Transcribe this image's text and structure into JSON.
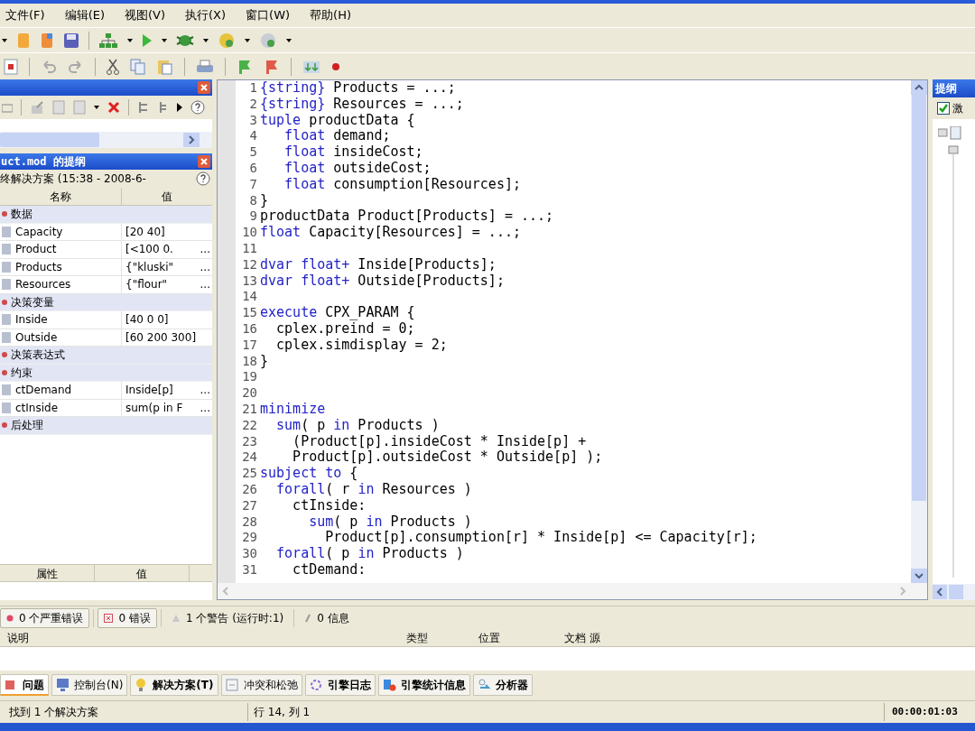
{
  "menu": [
    "文件(F)",
    "编辑(E)",
    "视图(V)",
    "执行(X)",
    "窗口(W)",
    "帮助(H)"
  ],
  "outline_panel": {
    "title": "uct.mod 的提纲",
    "solution": "终解决方案 (15:38 - 2008-6-",
    "columns": [
      "名称",
      "值"
    ],
    "groups": [
      {
        "label": "数据",
        "items": [
          {
            "name": "Capacity",
            "value": "[20 40]"
          },
          {
            "name": "Product",
            "value": "[<100 0.",
            "more": "..."
          },
          {
            "name": "Products",
            "value": "{\"kluski\"",
            "more": "..."
          },
          {
            "name": "Resources",
            "value": "{\"flour\"",
            "more": "..."
          }
        ]
      },
      {
        "label": "决策变量",
        "items": [
          {
            "name": "Inside",
            "value": "[40 0 0]"
          },
          {
            "name": "Outside",
            "value": "[60 200 300]"
          }
        ]
      },
      {
        "label": "决策表达式"
      },
      {
        "label": "约束",
        "items": [
          {
            "name": "ctDemand",
            "value": "Inside[p]",
            "more": "..."
          },
          {
            "name": "ctInside",
            "value": "sum(p in F",
            "more": "..."
          }
        ]
      },
      {
        "label": "后处理"
      }
    ],
    "property_columns": [
      "属性",
      "值"
    ]
  },
  "editor": {
    "lines": [
      {
        "n": "1",
        "tokens": [
          {
            "t": "{string}",
            "kind": "keyword"
          },
          {
            "t": " Products = ...;",
            "kind": "plain"
          }
        ]
      },
      {
        "n": "2",
        "tokens": [
          {
            "t": "{string}",
            "kind": "keyword"
          },
          {
            "t": " Resources = ...;",
            "kind": "plain"
          }
        ]
      },
      {
        "n": "3",
        "tokens": [
          {
            "t": "tuple",
            "kind": "keyword"
          },
          {
            "t": " productData {",
            "kind": "plain"
          }
        ]
      },
      {
        "n": "4",
        "tokens": [
          {
            "t": "   float",
            "kind": "keyword"
          },
          {
            "t": " demand;",
            "kind": "plain"
          }
        ]
      },
      {
        "n": "5",
        "tokens": [
          {
            "t": "   float",
            "kind": "keyword"
          },
          {
            "t": " insideCost;",
            "kind": "plain"
          }
        ]
      },
      {
        "n": "6",
        "tokens": [
          {
            "t": "   float",
            "kind": "keyword"
          },
          {
            "t": " outsideCost;",
            "kind": "plain"
          }
        ]
      },
      {
        "n": "7",
        "tokens": [
          {
            "t": "   float",
            "kind": "keyword"
          },
          {
            "t": " consumption[Resources];",
            "kind": "plain"
          }
        ]
      },
      {
        "n": "8",
        "tokens": [
          {
            "t": "}",
            "kind": "plain"
          }
        ]
      },
      {
        "n": "9",
        "tokens": [
          {
            "t": "productData Product[Products] = ...;",
            "kind": "plain"
          }
        ]
      },
      {
        "n": "10",
        "tokens": [
          {
            "t": "float",
            "kind": "keyword"
          },
          {
            "t": " Capacity[Resources] = ...;",
            "kind": "plain"
          }
        ]
      },
      {
        "n": "11"
      },
      {
        "n": "12",
        "tokens": [
          {
            "t": "dvar float+",
            "kind": "keyword"
          },
          {
            "t": " Inside[Products];",
            "kind": "plain"
          }
        ]
      },
      {
        "n": "13",
        "tokens": [
          {
            "t": "dvar float+",
            "kind": "keyword"
          },
          {
            "t": " Outside[Products];",
            "kind": "plain"
          }
        ]
      },
      {
        "n": "14"
      },
      {
        "n": "15",
        "tokens": [
          {
            "t": "execute",
            "kind": "keyword"
          },
          {
            "t": " CPX_PARAM {",
            "kind": "plain"
          }
        ]
      },
      {
        "n": "16",
        "tokens": [
          {
            "t": "  cplex.preind = 0;",
            "kind": "plain"
          }
        ]
      },
      {
        "n": "17",
        "tokens": [
          {
            "t": "  cplex.simdisplay = 2;",
            "kind": "plain"
          }
        ]
      },
      {
        "n": "18",
        "tokens": [
          {
            "t": "}",
            "kind": "plain"
          }
        ]
      },
      {
        "n": "19"
      },
      {
        "n": "20"
      },
      {
        "n": "21",
        "tokens": [
          {
            "t": "minimize",
            "kind": "keyword"
          }
        ]
      },
      {
        "n": "22",
        "tokens": [
          {
            "t": "  sum",
            "kind": "keyword"
          },
          {
            "t": "( p ",
            "kind": "plain"
          },
          {
            "t": "in",
            "kind": "keyword"
          },
          {
            "t": " Products )",
            "kind": "plain"
          }
        ]
      },
      {
        "n": "23",
        "tokens": [
          {
            "t": "    (Product[p].insideCost * Inside[p] +",
            "kind": "plain"
          }
        ]
      },
      {
        "n": "24",
        "tokens": [
          {
            "t": "    Product[p].outsideCost * Outside[p] );",
            "kind": "plain"
          }
        ]
      },
      {
        "n": "25",
        "tokens": [
          {
            "t": "subject to",
            "kind": "keyword"
          },
          {
            "t": " {",
            "kind": "plain"
          }
        ]
      },
      {
        "n": "26",
        "tokens": [
          {
            "t": "  forall",
            "kind": "keyword"
          },
          {
            "t": "( r ",
            "kind": "plain"
          },
          {
            "t": "in",
            "kind": "keyword"
          },
          {
            "t": " Resources )",
            "kind": "plain"
          }
        ]
      },
      {
        "n": "27",
        "tokens": [
          {
            "t": "    ctInside:",
            "kind": "plain"
          }
        ]
      },
      {
        "n": "28",
        "tokens": [
          {
            "t": "      sum",
            "kind": "keyword"
          },
          {
            "t": "( p ",
            "kind": "plain"
          },
          {
            "t": "in",
            "kind": "keyword"
          },
          {
            "t": " Products )",
            "kind": "plain"
          }
        ]
      },
      {
        "n": "29",
        "tokens": [
          {
            "t": "        Product[p].consumption[r] * Inside[p] <= Capacity[r];",
            "kind": "plain"
          }
        ]
      },
      {
        "n": "30",
        "tokens": [
          {
            "t": "  forall",
            "kind": "keyword"
          },
          {
            "t": "( p ",
            "kind": "plain"
          },
          {
            "t": "in",
            "kind": "keyword"
          },
          {
            "t": " Products )",
            "kind": "plain"
          }
        ]
      },
      {
        "n": "31",
        "tokens": [
          {
            "t": "    ctDemand:",
            "kind": "plain"
          }
        ]
      }
    ]
  },
  "right_panel": {
    "title": "提纲",
    "checkbox": {
      "label": "激",
      "checked": true
    }
  },
  "problems": {
    "filters": [
      {
        "label": "0 个严重错误",
        "kind": "fatal",
        "selected": true
      },
      {
        "label": "0 错误",
        "kind": "error",
        "selected": true
      },
      {
        "label": "1 个警告 (运行时:1)",
        "kind": "warning",
        "selected": false
      },
      {
        "label": "0 信息",
        "kind": "info",
        "selected": false
      }
    ],
    "columns": [
      "说明",
      "类型",
      "位置",
      "文档 源"
    ]
  },
  "tabs": [
    {
      "label": "问题",
      "selected": true,
      "updated": true
    },
    {
      "label": "控制台(N)",
      "selected": false,
      "updated": false
    },
    {
      "label": "解决方案(T)",
      "selected": false,
      "updated": true
    },
    {
      "label": "冲突和松弛",
      "selected": false,
      "updated": false
    },
    {
      "label": "引擎日志",
      "selected": false,
      "updated": true
    },
    {
      "label": "引擎统计信息",
      "selected": false,
      "updated": true
    },
    {
      "label": "分析器",
      "selected": false,
      "updated": true
    }
  ],
  "status_bar": {
    "message": "找到 1 个解决方案",
    "position": "行 14, 列 1",
    "timer": "00:00:01:03"
  }
}
